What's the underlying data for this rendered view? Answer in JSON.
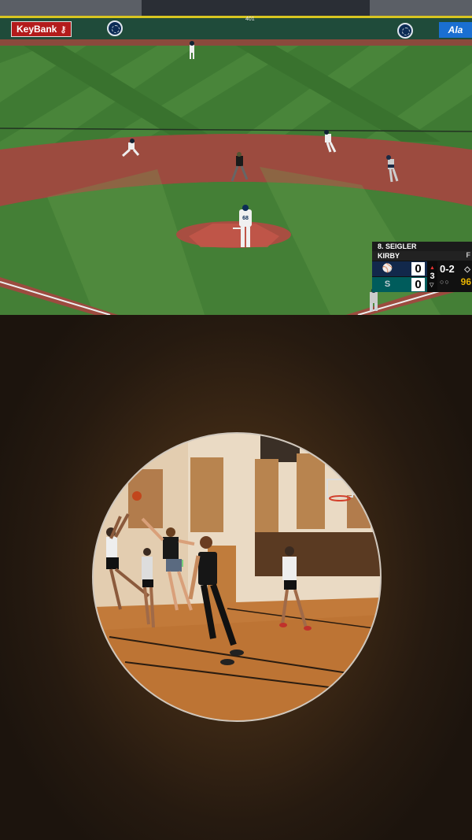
{
  "broadcast": {
    "ads": {
      "keybank": "KeyBank",
      "key_icon": "key-icon",
      "outfield_distance": "401",
      "alaska": "Ala"
    },
    "scorebug": {
      "batter": "8. SEIGLER",
      "pitcher": "KIRBY",
      "pitcher_suffix": "F",
      "away_logo_icon": "brewers-logo-icon",
      "home_logo_icon": "mariners-logo-icon",
      "away_score": "0",
      "home_score": "0",
      "inning": "3",
      "count": "0-2",
      "bases": "◇",
      "outs": "○○",
      "pitch_count": "96",
      "pitcher_number": "68"
    },
    "colors": {
      "grass": "#3f7a33",
      "dirt": "#9c4b3f",
      "brewers_navy": "#12284b",
      "mariners_teal": "#005c5c"
    }
  },
  "circle_video": {
    "scene": "indoor-basketball-game",
    "colors": {
      "ring": "#cfc7bd",
      "wall": "#eadac4",
      "floor": "#c27a3a"
    }
  }
}
